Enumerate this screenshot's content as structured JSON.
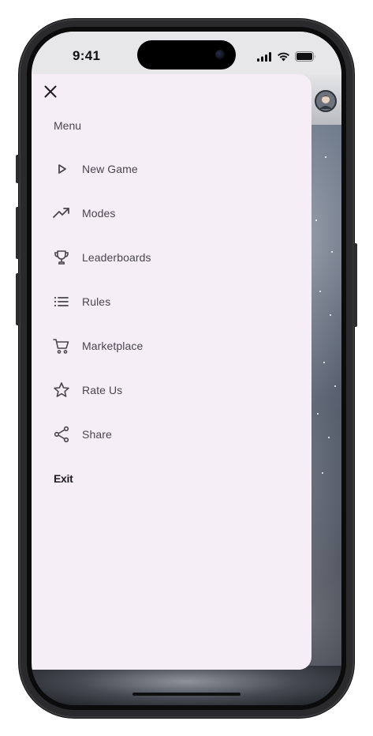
{
  "status_bar": {
    "time": "9:41"
  },
  "drawer": {
    "header": "Menu",
    "items": [
      {
        "label": "New Game",
        "icon": "play-icon"
      },
      {
        "label": "Modes",
        "icon": "trending-up-icon"
      },
      {
        "label": "Leaderboards",
        "icon": "trophy-icon"
      },
      {
        "label": "Rules",
        "icon": "list-icon"
      },
      {
        "label": "Marketplace",
        "icon": "cart-icon"
      },
      {
        "label": "Rate Us",
        "icon": "star-icon"
      },
      {
        "label": "Share",
        "icon": "share-icon"
      }
    ],
    "exit_label": "Exit"
  },
  "colors": {
    "drawer_bg": "#f5eef7",
    "text": "#49454f",
    "icon": "#49454f",
    "exit_text": "#1d1b20"
  }
}
